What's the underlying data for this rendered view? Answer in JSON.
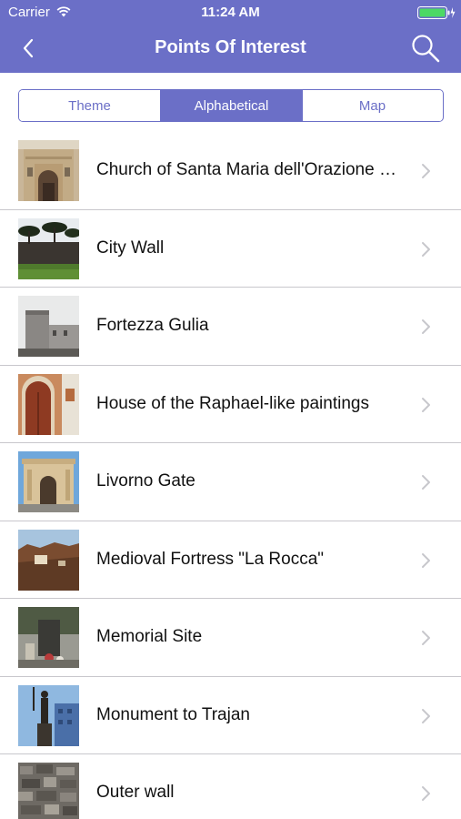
{
  "status_bar": {
    "carrier": "Carrier",
    "time": "11:24 AM",
    "wifi_icon": "wifi-icon",
    "battery_icon": "battery-charging-icon"
  },
  "nav": {
    "title": "Points Of Interest",
    "back_icon": "chevron-left-icon",
    "search_icon": "search-icon"
  },
  "colors": {
    "accent": "#6b6fc7",
    "separator": "#c8c7cc",
    "chevron": "#c7c7cc"
  },
  "segments": {
    "selected": "Alphabetical",
    "items": [
      {
        "label": "Theme"
      },
      {
        "label": "Alphabetical"
      },
      {
        "label": "Map"
      }
    ]
  },
  "points": [
    {
      "name": "Church of Santa Maria dell'Orazione e Morte",
      "thumbnail": "church-facade-photo"
    },
    {
      "name": "City Wall",
      "thumbnail": "city-wall-photo"
    },
    {
      "name": "Fortezza Gulia",
      "thumbnail": "fortress-photo"
    },
    {
      "name": "House of the Raphael-like paintings",
      "thumbnail": "house-door-photo"
    },
    {
      "name": "Livorno Gate",
      "thumbnail": "gate-photo"
    },
    {
      "name": "Medioval Fortress \"La Rocca\"",
      "thumbnail": "fortress-ruins-photo"
    },
    {
      "name": "Memorial Site",
      "thumbnail": "memorial-photo"
    },
    {
      "name": "Monument to Trajan",
      "thumbnail": "statue-photo"
    },
    {
      "name": "Outer wall",
      "thumbnail": "stone-wall-photo"
    }
  ]
}
